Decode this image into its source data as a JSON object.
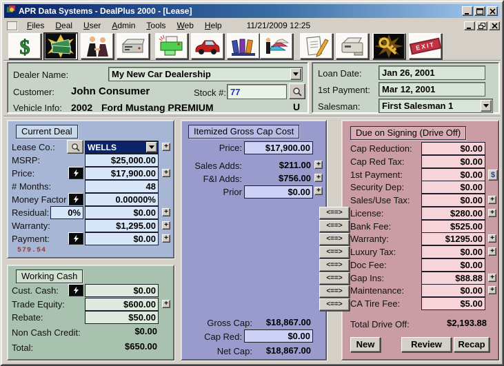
{
  "window": {
    "title": "APR Data Systems - DealPlus 2000 - [Lease]",
    "datetime": "11/21/2009 12:25",
    "menus": [
      "Files",
      "Deal",
      "User",
      "Admin",
      "Tools",
      "Web",
      "Help"
    ]
  },
  "toolbar": {
    "exit_label": "EXIT",
    "icons": [
      "dollar-icon",
      "cash-deal-icon",
      "handshake-icon",
      "fax-icon",
      "printer-icon",
      "car-icon",
      "library-icon",
      "inventory-icon",
      "forms-icon",
      "copier-icon",
      "security-key-icon",
      "exit-icon"
    ]
  },
  "adorners": {
    "plus": "+",
    "dollar": "$"
  },
  "header": {
    "dealer_label": "Dealer Name:",
    "dealer_value": "My New Car Dealership",
    "customer_label": "Customer:",
    "customer_value": "John Consumer",
    "stock_label": "Stock #:",
    "stock_value": "77",
    "vehicle_label": "Vehicle Info:",
    "vehicle_year": "2002",
    "vehicle_desc": "Ford Mustang PREMIUM",
    "used_flag": "U",
    "loan_date_label": "Loan Date:",
    "loan_date": "Jan 26, 2001",
    "first_payment_label": "1st Payment:",
    "first_payment": "Mar 12, 2001",
    "salesman_label": "Salesman:",
    "salesman": "First Salesman 1"
  },
  "current_deal": {
    "title": "Current Deal",
    "rows": [
      {
        "label": "Lease Co.:",
        "value": "WELLS"
      },
      {
        "label": "MSRP:",
        "value": "$25,000.00"
      },
      {
        "label": "Price:",
        "value": "$17,900.00"
      },
      {
        "label": "# Months:",
        "value": "48"
      },
      {
        "label": "Money Factor",
        "value": "0.00000%"
      },
      {
        "label": "Residual:",
        "pct": "0%",
        "value": "$0.00"
      },
      {
        "label": "Warranty:",
        "value": "$1,295.00"
      },
      {
        "label": "Payment:",
        "value": "$0.00"
      }
    ],
    "payment_calc": "579.54"
  },
  "working_cash": {
    "title": "Working Cash",
    "rows": [
      {
        "label": "Cust. Cash:",
        "value": "$0.00"
      },
      {
        "label": "Trade Equity:",
        "value": "$600.00"
      },
      {
        "label": "Rebate:",
        "value": "$50.00"
      },
      {
        "label": "Non Cash Credit:",
        "value": "$0.00"
      },
      {
        "label": "Total:",
        "value": "$650.00"
      }
    ]
  },
  "cap_cost": {
    "title": "Itemized Gross Cap Cost",
    "rows": [
      {
        "label": "Price:",
        "value": "$17,900.00"
      },
      {
        "label": "Sales Adds:",
        "value": "$211.00"
      },
      {
        "label": "F&I Adds:",
        "value": "$756.00"
      },
      {
        "label": "Prior",
        "value": "$0.00"
      }
    ],
    "summary": [
      {
        "label": "Gross Cap:",
        "value": "$18,867.00"
      },
      {
        "label": "Cap Red:",
        "value": "$0.00"
      },
      {
        "label": "Net Cap:",
        "value": "$18,867.00"
      }
    ]
  },
  "drive_off": {
    "title": "Due on Signing (Drive Off)",
    "rows": [
      {
        "label": "Cap Reduction:",
        "value": "$0.00"
      },
      {
        "label": "Cap Red Tax:",
        "value": "$0.00"
      },
      {
        "label": "1st Payment:",
        "value": "$0.00"
      },
      {
        "label": "Security Dep:",
        "value": "$0.00"
      },
      {
        "label": "Sales/Use Tax:",
        "value": "$0.00"
      },
      {
        "label": "License:",
        "value": "$280.00"
      },
      {
        "label": "Bank Fee:",
        "value": "$525.00"
      },
      {
        "label": "Warranty:",
        "value": "$1295.00"
      },
      {
        "label": "Luxury Tax:",
        "value": "$0.00"
      },
      {
        "label": "Doc Fee:",
        "value": "$0.00"
      },
      {
        "label": "Gap Ins:",
        "value": "$88.88"
      },
      {
        "label": "Maintenance:",
        "value": "$0.00"
      },
      {
        "label": "CA Tire Fee:",
        "value": "$5.00"
      }
    ],
    "total_label": "Total Drive Off:",
    "total_value": "$2,193.88",
    "buttons": {
      "new": "New",
      "review": "Review",
      "recap": "Recap"
    }
  },
  "transfer": {
    "label": "<==>"
  },
  "colors": {
    "titlebar_start": "#0A246A",
    "titlebar_end": "#A6CAF0",
    "chrome": "#D4D0C8",
    "deal_panel": "#A6B6D4",
    "cash_panel": "#A9C1AF",
    "cap_panel": "#999BCC",
    "driveoff_panel": "#CA9CA4",
    "calc_text": "#99352B",
    "stock_text": "#2230C8"
  }
}
